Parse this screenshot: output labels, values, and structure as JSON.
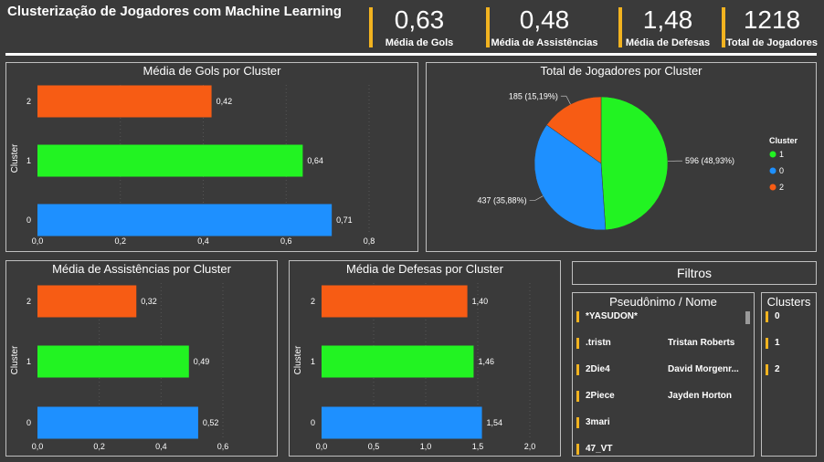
{
  "header": {
    "title": "Clusterização de Jogadores com Machine Learning"
  },
  "kpis": [
    {
      "value": "0,63",
      "label": "Média de Gols"
    },
    {
      "value": "0,48",
      "label": "Média de Assistências"
    },
    {
      "value": "1,48",
      "label": "Média de Defesas"
    },
    {
      "value": "1218",
      "label": "Total de Jogadores"
    }
  ],
  "colors": {
    "cluster_0": "#1e90ff",
    "cluster_1": "#22f322",
    "cluster_2": "#f75c14",
    "accent": "#f2b320",
    "background": "#3a3a3a"
  },
  "chart_data": [
    {
      "type": "bar",
      "orientation": "horizontal",
      "title": "Média de Gols por Cluster",
      "ylabel": "Cluster",
      "categories": [
        "2",
        "1",
        "0"
      ],
      "values": [
        0.42,
        0.64,
        0.71
      ],
      "value_labels": [
        "0,42",
        "0,64",
        "0,71"
      ],
      "xticks": [
        "0,0",
        "0,2",
        "0,4",
        "0,6",
        "0,8"
      ],
      "xlim": [
        0,
        0.8
      ]
    },
    {
      "type": "pie",
      "title": "Total de Jogadores por Cluster",
      "legend_title": "Cluster",
      "legend_placement": "right",
      "categories": [
        "1",
        "0",
        "2"
      ],
      "values": [
        596,
        437,
        185
      ],
      "value_labels": [
        "596 (48,93%)",
        "437 (35,88%)",
        "185 (15,19%)"
      ]
    },
    {
      "type": "bar",
      "orientation": "horizontal",
      "title": "Média de Assistências por Cluster",
      "ylabel": "Cluster",
      "categories": [
        "2",
        "1",
        "0"
      ],
      "values": [
        0.32,
        0.49,
        0.52
      ],
      "value_labels": [
        "0,32",
        "0,49",
        "0,52"
      ],
      "xticks": [
        "0,0",
        "0,2",
        "0,4",
        "0,6"
      ],
      "xlim": [
        0,
        0.6
      ]
    },
    {
      "type": "bar",
      "orientation": "horizontal",
      "title": "Média de Defesas por Cluster",
      "ylabel": "Cluster",
      "categories": [
        "2",
        "1",
        "0"
      ],
      "values": [
        1.4,
        1.46,
        1.54
      ],
      "value_labels": [
        "1,40",
        "1,46",
        "1,54"
      ],
      "xticks": [
        "0,0",
        "0,5",
        "1,0",
        "1,5",
        "2,0"
      ],
      "xlim": [
        0,
        2.0
      ]
    }
  ],
  "filters": {
    "title": "Filtros",
    "names_title": "Pseudônimo / Nome",
    "names": [
      "*YASUDON*",
      ".tristn",
      "Tristan Roberts",
      "2Die4",
      "David Morgenr...",
      "2Piece",
      "Jayden Horton",
      "3mari",
      "47_VT"
    ],
    "clusters_title": "Clusters",
    "clusters": [
      "0",
      "1",
      "2"
    ]
  }
}
